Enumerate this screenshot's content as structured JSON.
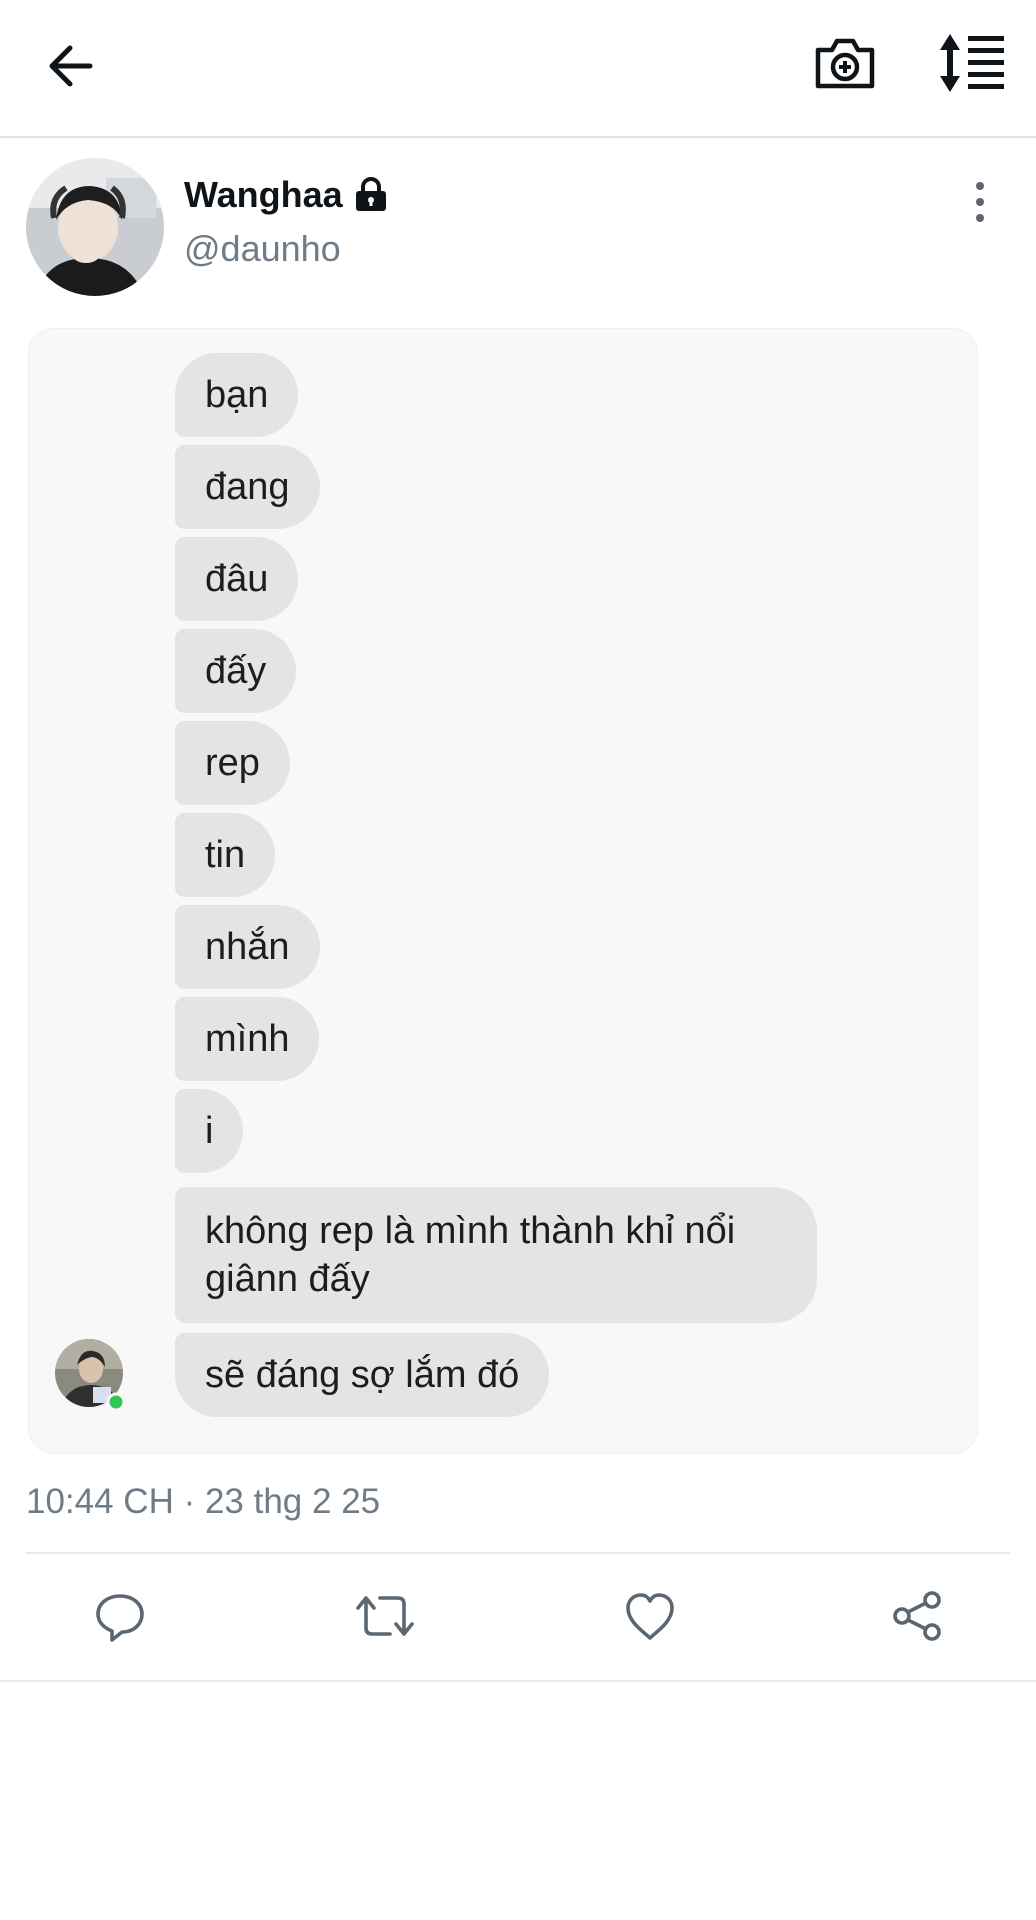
{
  "header": {
    "back": "back-arrow-icon",
    "camera": "camera-plus-icon",
    "sort": "sort-list-icon"
  },
  "profile": {
    "display_name": "Wanghaa",
    "handle": "@daunho",
    "protected_icon": "lock-icon",
    "more_icon": "more-vertical-icon"
  },
  "messages": [
    "bạn",
    "đang",
    "đâu",
    "đấy",
    "rep",
    "tin",
    "nhắn",
    "mình",
    "i",
    "không rep là mình thành khỉ nổi giânn đấy",
    "sẽ đáng sợ lắm đó"
  ],
  "timestamp": "10:44 CH · 23 thg 2 25",
  "actions": [
    "reply-icon",
    "retweet-icon",
    "like-icon",
    "share-icon"
  ],
  "colors": {
    "bubble": "#e4e4e4",
    "card": "#f8f8f8",
    "muted_text": "#6f7b86",
    "online_dot": "#31c553"
  }
}
